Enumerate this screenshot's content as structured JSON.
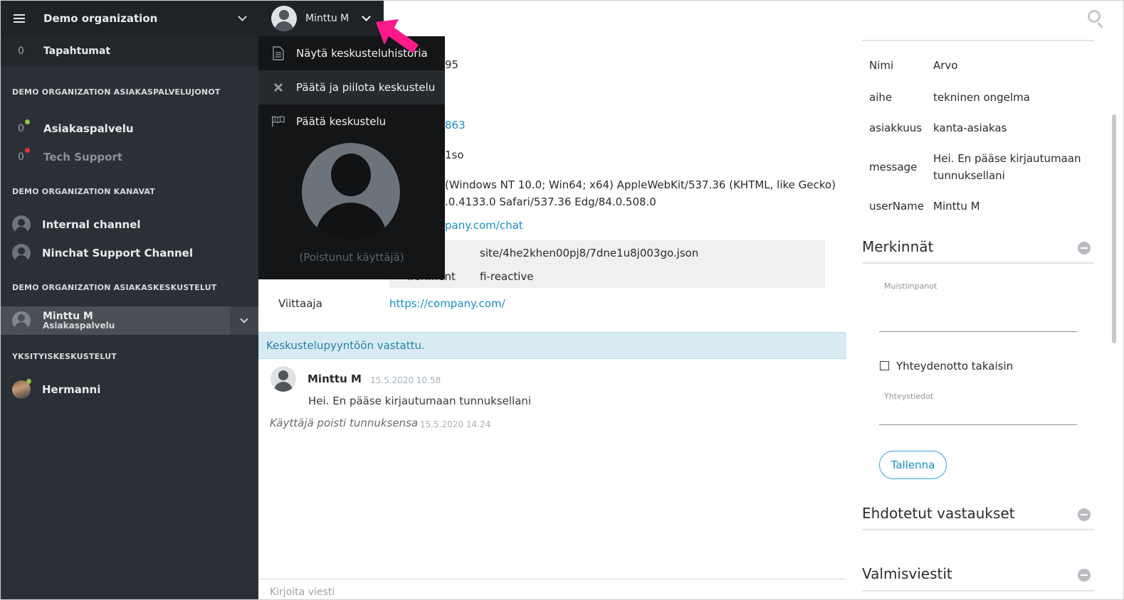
{
  "sidebar": {
    "org_name": "Demo organization",
    "events": {
      "count": "0",
      "label": "Tapahtumat"
    },
    "queues_title": "DEMO ORGANIZATION ASIAKASPALVELUJONOT",
    "queues": [
      {
        "count": "0",
        "label": "Asiakaspalvelu",
        "status_color": "#8dc63f"
      },
      {
        "count": "0",
        "label": "Tech Support",
        "status_color": "#d9363e"
      }
    ],
    "channels_title": "DEMO ORGANIZATION KANAVAT",
    "channels": [
      {
        "label": "Internal channel"
      },
      {
        "label": "Ninchat Support Channel"
      }
    ],
    "conversations_title": "DEMO ORGANIZATION ASIAKASKESKUSTELUT",
    "active_conversation": {
      "name": "Minttu M",
      "queue": "Asiakaspalvelu"
    },
    "private_title": "YKSITYISKESKUSTELUT",
    "private": [
      {
        "label": "Hermanni",
        "status_color": "#8dc63f"
      }
    ]
  },
  "user_menu": {
    "name": "Minttu M",
    "items": [
      {
        "label": "Näytä keskusteluhistoria",
        "icon": "document-icon"
      },
      {
        "label": "Päätä ja piilota keskustelu",
        "icon": "close-icon"
      },
      {
        "label": "Päätä keskustelu",
        "icon": "flag-icon"
      }
    ],
    "left_user": "(Poistunut käyttäjä)"
  },
  "main": {
    "partial": {
      "line1": "95",
      "line2": "863",
      "line3": "1so",
      "ua_line1": "(Windows NT 10.0; Win64; x64) AppleWebKit/537.36 (KHTML, like Gecko)",
      "ua_line2": ".0.4133.0 Safari/537.36 Edg/84.0.508.0",
      "url_partial": "pany.com/chat"
    },
    "info_box": {
      "row1_value": "site/4he2khen00pj8/7dne1u8j003go.json",
      "row2_key_partial": "ironment",
      "row2_value": "fi-reactive"
    },
    "referrer": {
      "label": "Viittaaja",
      "value": "https://company.com/"
    },
    "notice": "Keskustelupyyntöön vastattu.",
    "message": {
      "author": "Minttu M",
      "time": "15.5.2020 10.58",
      "text": "Hei. En pääse kirjautumaan tunnuksellani"
    },
    "system": {
      "text": "Käyttäjä poisti tunnuksensa",
      "time": "15.5.2020 14.24"
    },
    "composer_placeholder": "Kirjoita viesti"
  },
  "right": {
    "details": [
      {
        "key": "Nimi",
        "value": "Arvo"
      },
      {
        "key": "aihe",
        "value": "tekninen ongelma"
      },
      {
        "key": "asiakkuus",
        "value": "kanta-asiakas"
      },
      {
        "key": "message",
        "value": "Hei. En pääse kirjautumaan tunnuksellani"
      },
      {
        "key": "userName",
        "value": "Minttu M"
      }
    ],
    "notes_title": "Merkinnät",
    "notes_label": "Muistiinpanot",
    "callback_label": "Yhteydenotto takaisin",
    "contact_label": "Yhteystiedot",
    "save_label": "Tallenna",
    "suggested_title": "Ehdotetut vastaukset",
    "canned_title": "Valmisviestit"
  },
  "colors": {
    "sidebar_bg": "#2b3036",
    "accent": "#1a8fc4",
    "arrow": "#ff1a8c"
  }
}
